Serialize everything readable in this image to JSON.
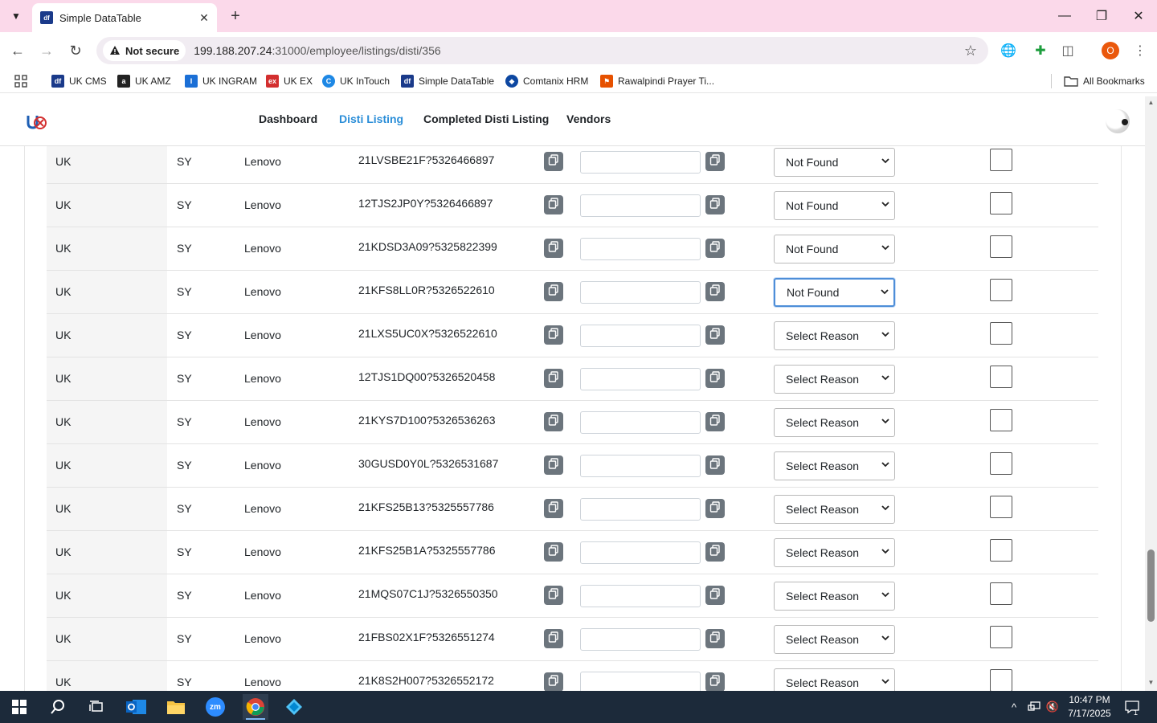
{
  "browser": {
    "tab_title": "Simple DataTable",
    "tab_favicon": "df",
    "security_label": "Not secure",
    "url_host": "199.188.207.24",
    "url_rest": ":31000/employee/listings/disti/356",
    "profile_initial": "O",
    "bookmarks": [
      {
        "label": "UK CMS",
        "icon": "df",
        "color": "#1a3a8a"
      },
      {
        "label": "UK AMZ",
        "icon": "a",
        "color": "#222222"
      },
      {
        "label": "UK INGRAM",
        "icon": "I",
        "color": "#1b6fd6"
      },
      {
        "label": "UK EX",
        "icon": "ex",
        "color": "#d32f2f"
      },
      {
        "label": "UK InTouch",
        "icon": "C",
        "color": "#1e88e5"
      },
      {
        "label": "Simple DataTable",
        "icon": "df",
        "color": "#1a3a8a"
      },
      {
        "label": "Comtanix HRM",
        "icon": "◆",
        "color": "#0d47a1"
      },
      {
        "label": "Rawalpindi Prayer Ti...",
        "icon": "⚑",
        "color": "#e65100"
      }
    ],
    "all_bookmarks": "All Bookmarks"
  },
  "nav": {
    "links": [
      "Dashboard",
      "Disti Listing",
      "Completed Disti Listing",
      "Vendors"
    ],
    "active": "Disti Listing"
  },
  "rows": [
    {
      "country": "UK",
      "region": "SY",
      "vendor": "Lenovo",
      "part": "21LVSBE21F?5326466897",
      "reason": "Not Found"
    },
    {
      "country": "UK",
      "region": "SY",
      "vendor": "Lenovo",
      "part": "12TJS2JP0Y?5326466897",
      "reason": "Not Found"
    },
    {
      "country": "UK",
      "region": "SY",
      "vendor": "Lenovo",
      "part": "21KDSD3A09?5325822399",
      "reason": "Not Found"
    },
    {
      "country": "UK",
      "region": "SY",
      "vendor": "Lenovo",
      "part": "21KFS8LL0R?5326522610",
      "reason": "Not Found",
      "focused": true
    },
    {
      "country": "UK",
      "region": "SY",
      "vendor": "Lenovo",
      "part": "21LXS5UC0X?5326522610",
      "reason": "Select Reason"
    },
    {
      "country": "UK",
      "region": "SY",
      "vendor": "Lenovo",
      "part": "12TJS1DQ00?5326520458",
      "reason": "Select Reason"
    },
    {
      "country": "UK",
      "region": "SY",
      "vendor": "Lenovo",
      "part": "21KYS7D100?5326536263",
      "reason": "Select Reason"
    },
    {
      "country": "UK",
      "region": "SY",
      "vendor": "Lenovo",
      "part": "30GUSD0Y0L?5326531687",
      "reason": "Select Reason"
    },
    {
      "country": "UK",
      "region": "SY",
      "vendor": "Lenovo",
      "part": "21KFS25B13?5325557786",
      "reason": "Select Reason"
    },
    {
      "country": "UK",
      "region": "SY",
      "vendor": "Lenovo",
      "part": "21KFS25B1A?5325557786",
      "reason": "Select Reason"
    },
    {
      "country": "UK",
      "region": "SY",
      "vendor": "Lenovo",
      "part": "21MQS07C1J?5326550350",
      "reason": "Select Reason"
    },
    {
      "country": "UK",
      "region": "SY",
      "vendor": "Lenovo",
      "part": "21FBS02X1F?5326551274",
      "reason": "Select Reason"
    },
    {
      "country": "UK",
      "region": "SY",
      "vendor": "Lenovo",
      "part": "21K8S2H007?5326552172",
      "reason": "Select Reason"
    }
  ],
  "taskbar": {
    "time": "10:47 PM",
    "date": "7/17/2025",
    "notifications": "1"
  },
  "colors": {
    "accent": "#2b8ed8",
    "tabstrip": "#fbd9ea",
    "taskbar": "#1c2a3a",
    "copy_button": "#6c757d"
  }
}
